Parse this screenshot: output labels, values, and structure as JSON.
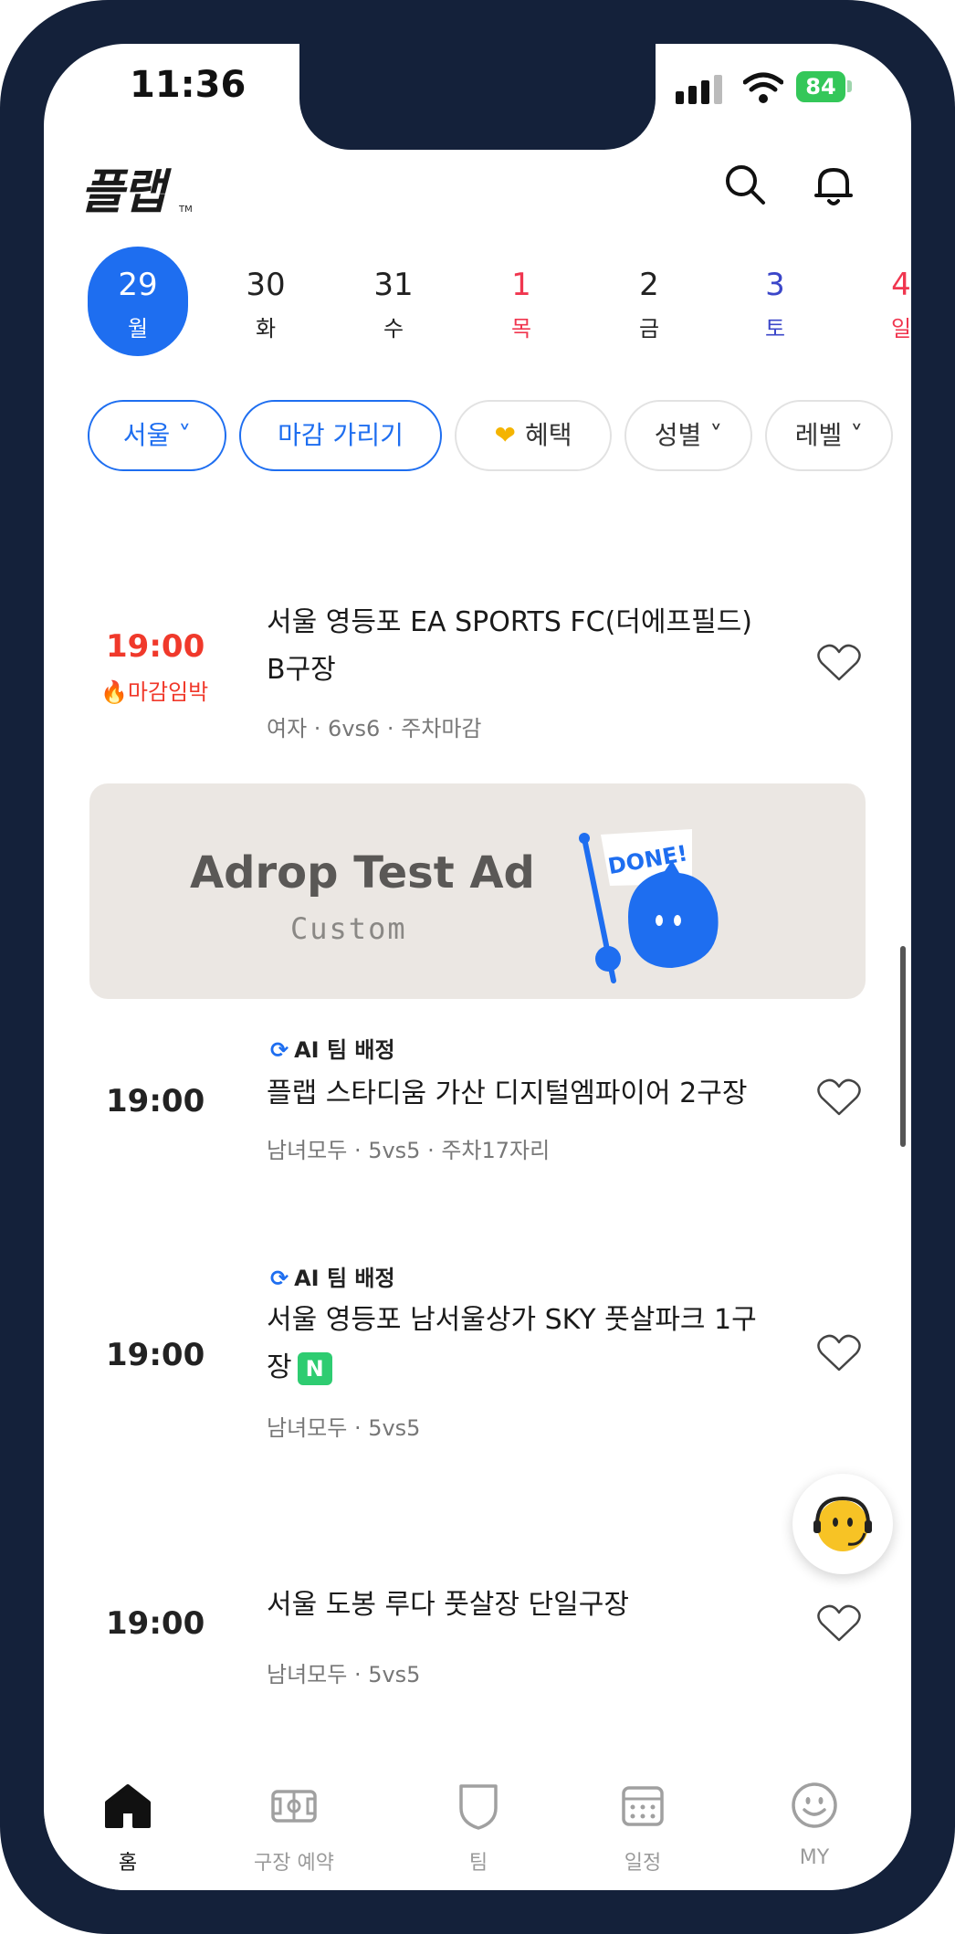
{
  "status_bar": {
    "time": "11:36",
    "battery": "84"
  },
  "header": {
    "logo": "플랩",
    "logo_tm": "TM"
  },
  "dates": [
    {
      "num": "29",
      "day": "월",
      "color": "active"
    },
    {
      "num": "30",
      "day": "화",
      "color": "normal"
    },
    {
      "num": "31",
      "day": "수",
      "color": "normal"
    },
    {
      "num": "1",
      "day": "목",
      "color": "red"
    },
    {
      "num": "2",
      "day": "금",
      "color": "normal"
    },
    {
      "num": "3",
      "day": "토",
      "color": "blue"
    },
    {
      "num": "4",
      "day": "일",
      "color": "red"
    }
  ],
  "filters": {
    "region": "서울 ˅",
    "hide_closed": "마감 가리기",
    "benefit": "혜택",
    "gender": "성별 ˅",
    "level": "레벨 ˅"
  },
  "matches": [
    {
      "time": "19:00",
      "badge": "🔥마감임박",
      "title": "서울 영등포 EA SPORTS FC(더에프필드) B구장",
      "meta": "여자 · 6vs6 · 주차마감"
    },
    {
      "ai": "AI 팀 배정",
      "time": "19:00",
      "title": "플랩 스타디움 가산 디지털엠파이어 2구장",
      "meta": "남녀모두 · 5vs5 · 주차17자리"
    },
    {
      "ai": "AI 팀 배정",
      "time": "19:00",
      "title": "서울 영등포 남서울상가 SKY 풋살파크 1구장",
      "new": "N",
      "meta": "남녀모두 · 5vs5"
    },
    {
      "time": "19:00",
      "title": "서울 도봉 루다 풋살장 단일구장",
      "meta": "남녀모두 · 5vs5"
    }
  ],
  "ad": {
    "title": "Adrop Test Ad",
    "subtitle": "Custom",
    "sticker": "DONE!"
  },
  "tabs": [
    {
      "label": "홈"
    },
    {
      "label": "구장 예약"
    },
    {
      "label": "팀"
    },
    {
      "label": "일정"
    },
    {
      "label": "MY"
    }
  ],
  "colors": {
    "primary": "#1e6ef0",
    "urgent": "#f0392b",
    "new_badge": "#2ecc71"
  }
}
